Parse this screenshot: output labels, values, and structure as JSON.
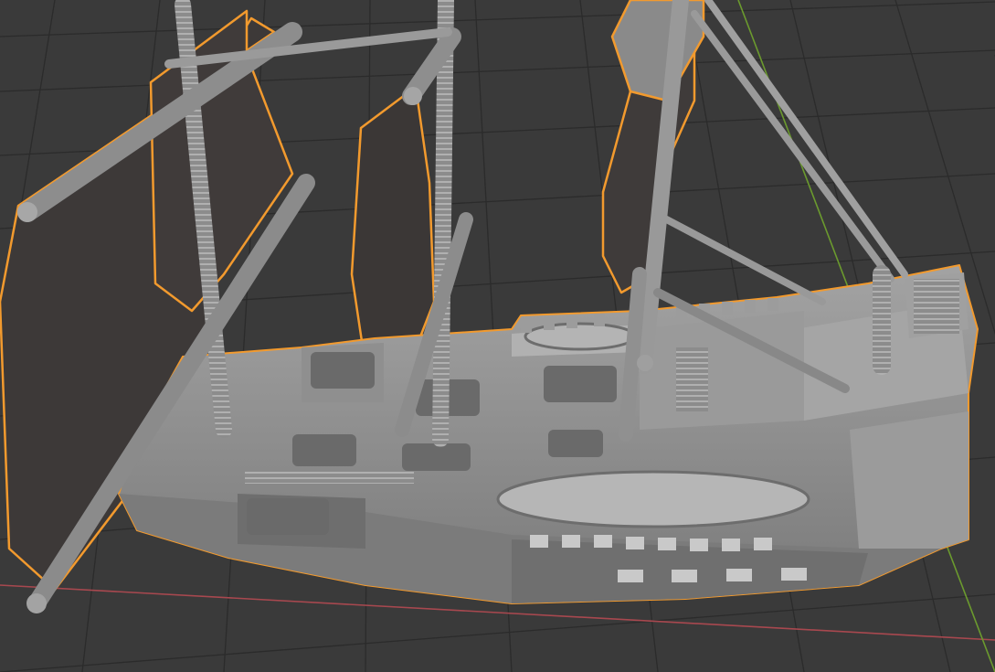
{
  "app": "3D viewport",
  "viewport": {
    "mode": "solid-shading",
    "background_color": "#3a3a3a",
    "grid_color": "#2b2b2b",
    "x_axis_color": "#a8484f",
    "y_axis_color": "#6b9a2e",
    "selection_outline_color": "#f29a2e"
  },
  "object": {
    "name": "",
    "selected": true,
    "base_color": "#8e8e8e",
    "sail_color": "#3e3a39",
    "icon": "sailing-ship-model"
  }
}
